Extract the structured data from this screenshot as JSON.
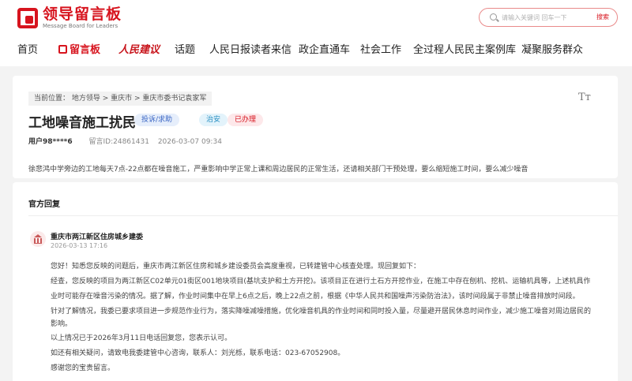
{
  "site": {
    "logo_title": "领导留言板",
    "logo_subtitle": "Message Board for Leaders",
    "search_placeholder": "请输入关键词 回车一下",
    "search_button": "搜索"
  },
  "nav": [
    "首页",
    "留言板",
    "人民建议",
    "话题",
    "人民日报读者来信",
    "政企直通车",
    "社会工作",
    "全过程人民民主案例库",
    "凝聚服务群众"
  ],
  "post": {
    "breadcrumb": "当前位置： 地方领导 > 重庆市 > 重庆市委书记袁家军",
    "title": "工地噪音施工扰民",
    "tags": {
      "type": "投诉/求助",
      "category": "治安",
      "status": "已办理"
    },
    "user": "用户98****6",
    "message_id": "留言ID:24861431",
    "date": "2026-03-07 09:34",
    "content": "徐悲鸿中学旁边的工地每天7点-22点都在噪音施工，严重影响中学正常上课和周边居民的正常生活，还请相关部门干预处理，要么缩短施工时间，要么减少噪音"
  },
  "reply": {
    "section_title": "官方回复",
    "department": "重庆市两江新区住房城乡建委",
    "time": "2026-03-13 17:16",
    "lines": [
      "您好！知悉您反映的问题后，重庆市两江新区住房和城乡建设委员会高度重视，已转建管中心核查处理。现回复如下：",
      "经查，您反映的项目为两江新区C02单元01街区001地块项目(基坑支护和土方开挖)。该项目正在进行土石方开挖作业，在施工中存在刨机、挖机、运输机具等，上述机具作",
      "业时可能存在噪音污染的情况。据了解，作业时间集中在早上6点之后，晚上22点之前，根据《中华人民共和国噪声污染防治法》，该时间段属于非禁止噪音排放时间段。",
      "针对了解情况，我委已要求项目进一步规范作业行为，落实降噪减噪措施，优化噪音机具的作业时间和同时投入量，尽量避开居民休息时间作业，减少施工噪音对周边居民的",
      "影响。",
      "以上情况已于2026年3月11日电话回复您，您表示认可。",
      "如还有相关疑问，请致电我委建管中心咨询，联系人：刘光栎，联系电话：023-67052908。",
      "感谢您的宝贵留言。"
    ]
  },
  "icons": {
    "logo": "message-board-logo-icon",
    "search": "search-icon",
    "font_size": "font-size-icon",
    "department": "government-building-icon"
  },
  "colors": {
    "brand": "#d7141e",
    "background": "#f3f3f3"
  }
}
